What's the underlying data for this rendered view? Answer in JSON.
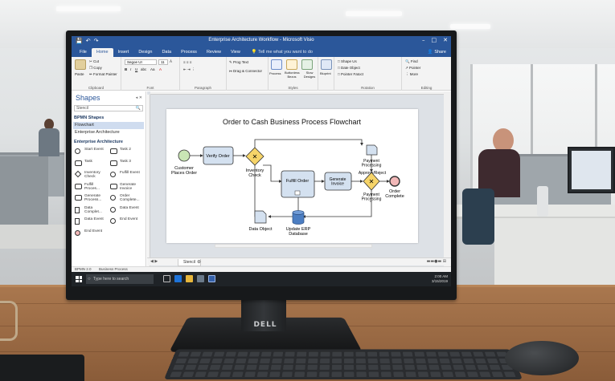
{
  "app": {
    "window_title": "Enterprise Architecture Workflow - Microsoft Visio",
    "tabs": [
      "File",
      "Home",
      "Insert",
      "Design",
      "Data",
      "Process",
      "Review",
      "View"
    ],
    "active_tab": "Home",
    "tell_me": "Tell me what you want to do",
    "share": "Share"
  },
  "ribbon": {
    "paste": "Paste",
    "cut": "Cut",
    "copy": "Copy",
    "format_painter": "Format Painter",
    "clipboard": "Clipboard",
    "font_name": "Segoe UI",
    "font_size": "11",
    "font": "Font",
    "paragraph": "Paragraph",
    "prog_text": "Prog Text",
    "drag_connector": "Drag & Connector",
    "styles": [
      "Process",
      "Buttonless Bezos",
      "Slow Designs"
    ],
    "styles_label": "Styles",
    "layout": "Layout",
    "shape_us": "Shape Us",
    "date_object": "Date Object",
    "pointer_fatoct": "Pointer Fatoct",
    "rotation": "Rotation",
    "find": "Find",
    "pointer_tool": "Pointer",
    "more": "More",
    "editing": "Editing",
    "bluprint": "Bluprint"
  },
  "shapes_pane": {
    "title": "Shapes",
    "search_placeholder": "Stencil",
    "sections": [
      "BPMN Shapes",
      "Flowchart",
      "Enterprise Architecture",
      "Enterprise Architecture"
    ],
    "items": [
      [
        "Start Event",
        "Task 2"
      ],
      [
        "Task",
        "Task 3"
      ],
      [
        "Inventory Check",
        "Fulfill Event"
      ],
      [
        "Fulfill Proces...",
        "Generate Invoice"
      ],
      [
        "Generate Process...",
        "Order Complete..."
      ],
      [
        "Data Complet...",
        "Data Event"
      ],
      [
        "Data Event",
        "End Event"
      ],
      [
        "End Event",
        ""
      ]
    ]
  },
  "page_tabs": {
    "stencil": "Stencil"
  },
  "status": {
    "left": "BPMN 2.0",
    "process": "Business Process"
  },
  "taskbar": {
    "search": "Type here to search",
    "time": "2:00 AM",
    "date": "3/15/2019"
  },
  "diagram": {
    "title": "Order to Cash Business Process Flowchart",
    "customer": "Customer Places Order",
    "verify": "Verify Order",
    "inventory": "Inventory Check",
    "payment1": "Payment Processing",
    "approve": "Approve/Reject",
    "fulfill": "Fulfill Order",
    "invoice": "Generate Invoice",
    "payment2": "Payment Processing",
    "complete": "Order Complete",
    "data_object": "Data Object",
    "erp": "Update ERP Database"
  },
  "monitor": {
    "brand": "DELL"
  }
}
